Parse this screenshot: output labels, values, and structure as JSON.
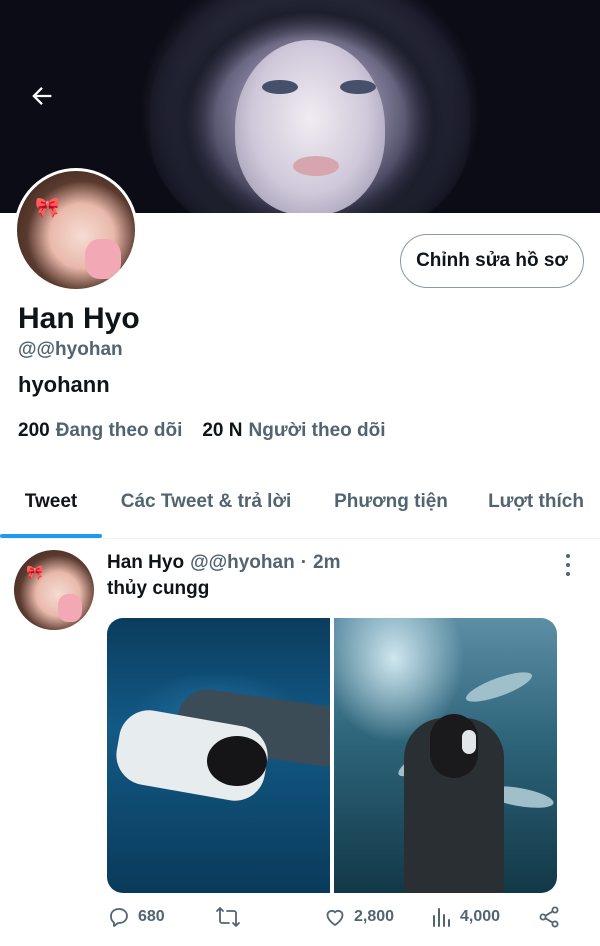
{
  "header": {
    "back_icon": "arrow-left-icon"
  },
  "profile": {
    "display_name": "Han Hyo",
    "handle": "@@hyohan",
    "bio": "hyohann",
    "edit_button_label": "Chỉnh sửa hồ sơ",
    "following_count": "200",
    "following_label": "Đang theo dõi",
    "followers_count": "20 N",
    "followers_label": "Người theo dõi"
  },
  "tabs": [
    {
      "label": "Tweet",
      "active": true
    },
    {
      "label": "Các Tweet & trả lời",
      "active": false
    },
    {
      "label": "Phương tiện",
      "active": false
    },
    {
      "label": "Lượt thích",
      "active": false
    }
  ],
  "tweet": {
    "author_name": "Han Hyo",
    "author_handle": "@@hyohan",
    "separator": "·",
    "time": "2m",
    "text": "thủy cungg",
    "media_count": 2,
    "replies": "680",
    "likes": "2,800",
    "views": "4,000"
  },
  "colors": {
    "accent": "#1d9bf0",
    "text_primary": "#0f1419",
    "text_secondary": "#536471",
    "divider": "#eff3f4"
  }
}
